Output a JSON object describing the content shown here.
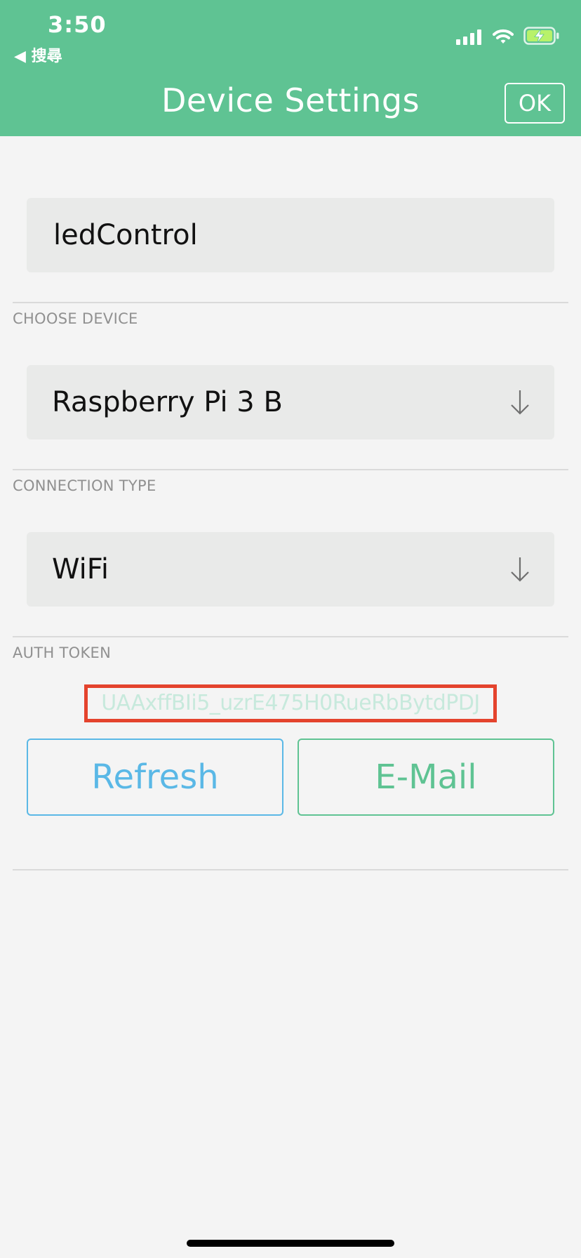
{
  "status_bar": {
    "time": "3:50",
    "back_app": "◀ 搜尋",
    "icons": [
      "cellular-signal-icon",
      "wifi-icon",
      "battery-charging-icon"
    ]
  },
  "header": {
    "title": "Device Settings",
    "ok_label": "OK"
  },
  "form": {
    "project_name": "ledControl",
    "choose_device": {
      "label": "CHOOSE DEVICE",
      "value": "Raspberry Pi 3 B"
    },
    "connection_type": {
      "label": "CONNECTION TYPE",
      "value": "WiFi"
    },
    "auth_token": {
      "label": "AUTH TOKEN",
      "value": "UAAxffBIi5_uzrE475H0RueRbBytdPDJ"
    }
  },
  "actions": {
    "refresh_label": "Refresh",
    "email_label": "E-Mail"
  },
  "colors": {
    "header": "#5fc393",
    "refresh": "#5ab8e6",
    "email": "#5fc393",
    "highlight_box": "#e4432d",
    "token_text": "#c7e9dc"
  }
}
